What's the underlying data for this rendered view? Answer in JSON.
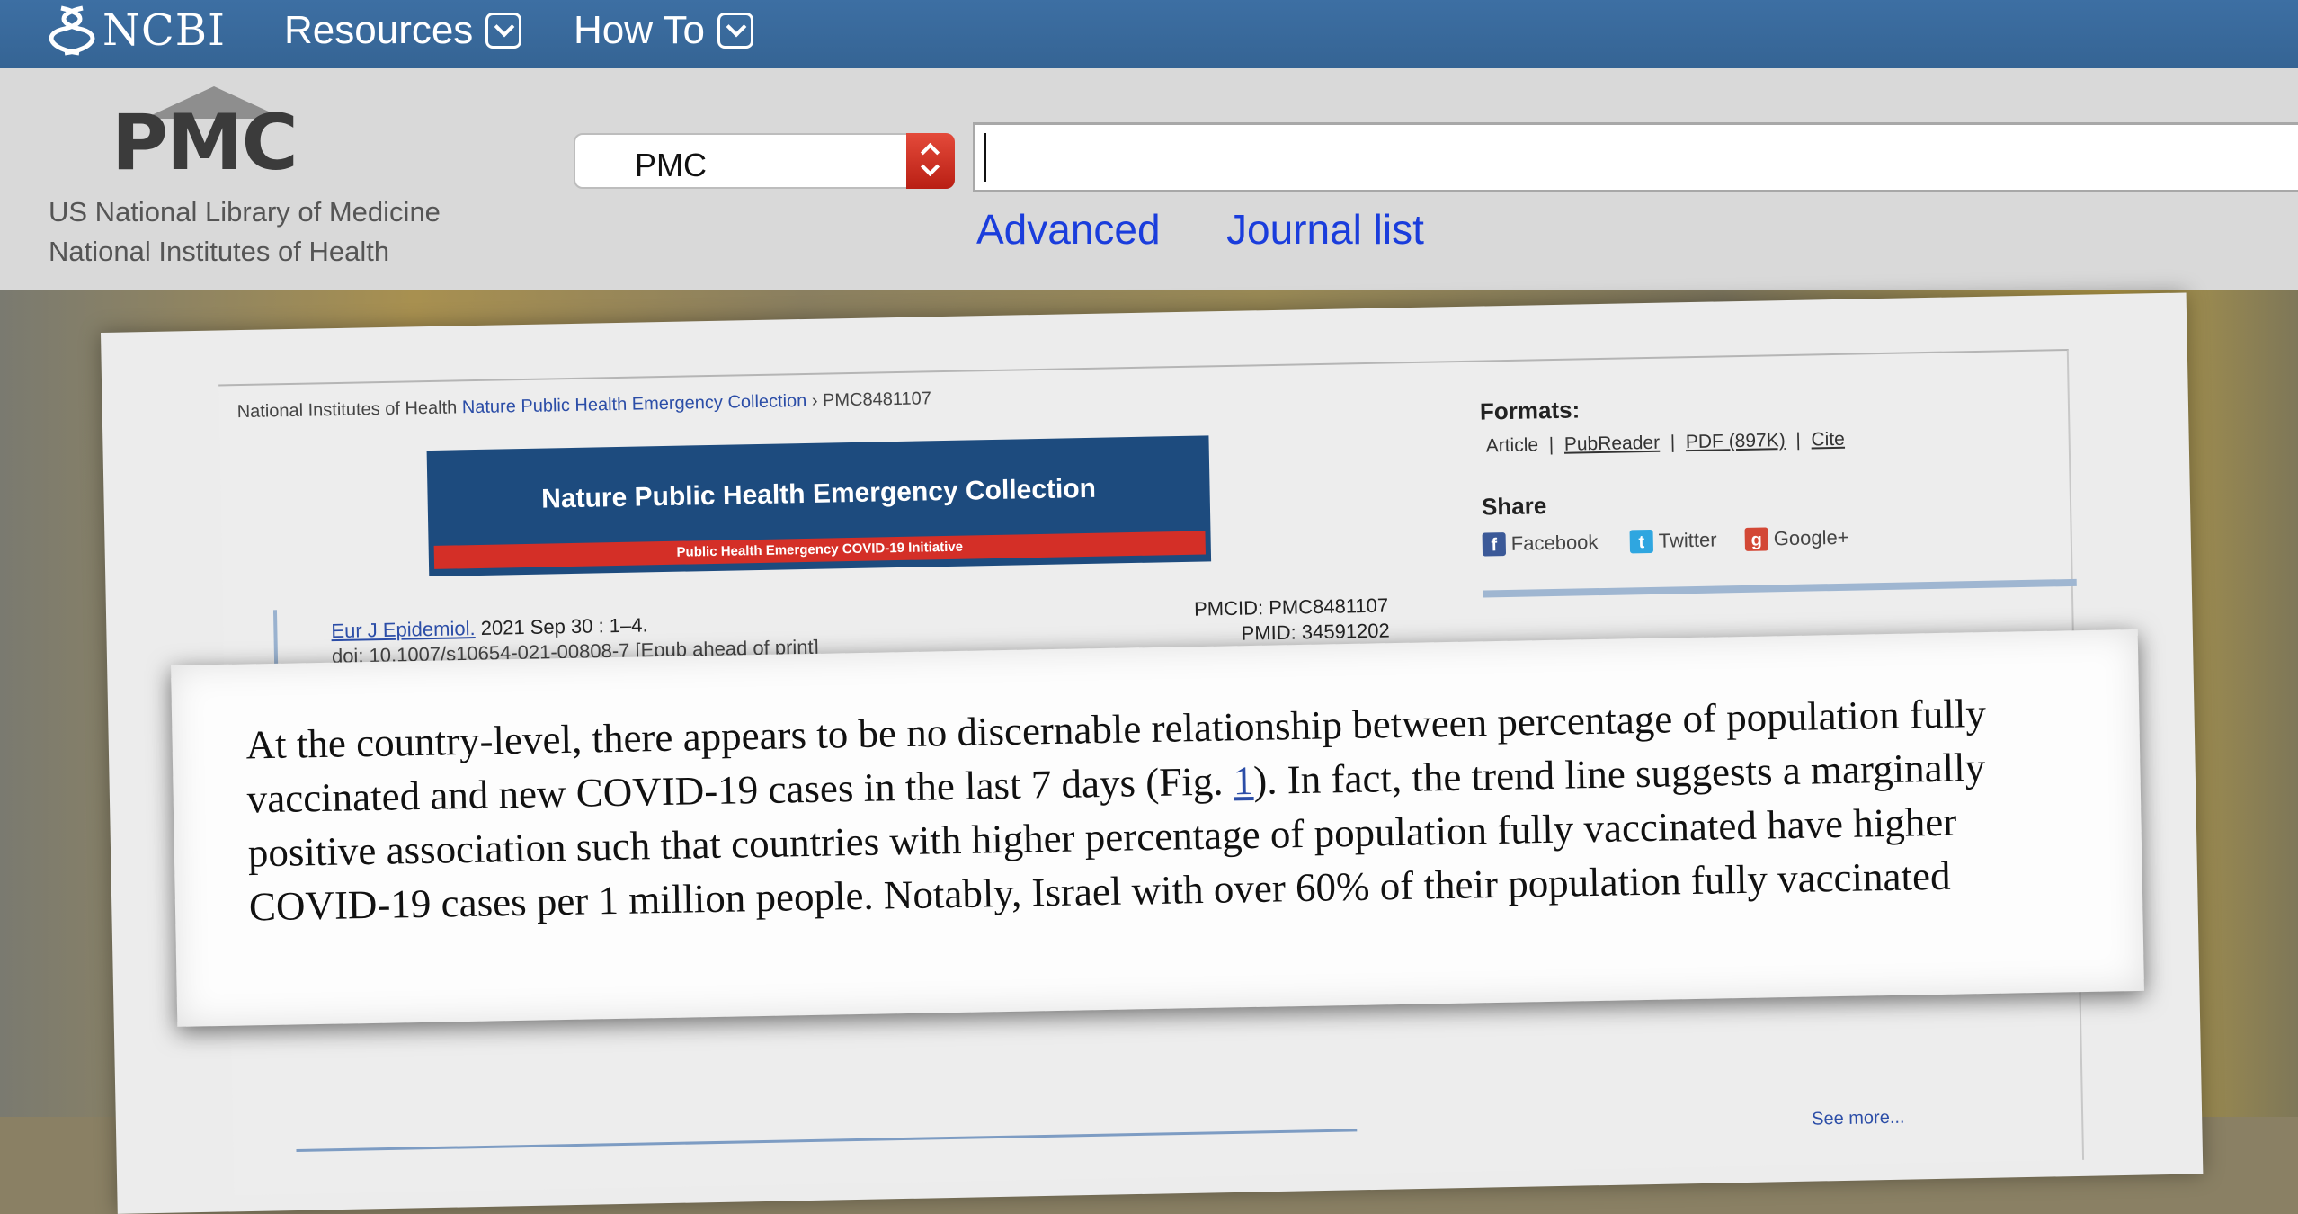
{
  "ncbi_bar": {
    "logo_text": "NCBI",
    "menu": [
      {
        "label": "Resources"
      },
      {
        "label": "How To"
      }
    ]
  },
  "pmc_header": {
    "logo_text": "PMC",
    "org_line1": "US National Library of Medicine",
    "org_line2": "National Institutes of Health",
    "database_select": "PMC",
    "search_value": "",
    "links": {
      "advanced": "Advanced",
      "journal_list": "Journal list"
    }
  },
  "article_page": {
    "breadcrumb_prefix": "National Institutes of Health",
    "breadcrumb_link": "Nature Public Health Emergency Collection",
    "breadcrumb_current": "› PMC8481107",
    "banner_title": "Nature Public Health Emergency Collection",
    "banner_subtitle": "Public Health Emergency COVID-19 Initiative",
    "journal": "Eur J Epidemiol.",
    "journal_date": "2021 Sep 30 : 1–4.",
    "doi": "doi: 10.1007/s10654-021-00808-7 [Epub ahead of print]",
    "pmcid": "PMCID: PMC8481107",
    "pmid": "PMID: 34591202",
    "formats_heading": "Formats:",
    "formats": {
      "article": "Article",
      "pubreader": "PubReader",
      "pdf": "PDF (897K)",
      "cite": "Cite"
    },
    "share_heading": "Share",
    "share": {
      "facebook": "Facebook",
      "twitter": "Twitter",
      "google": "Google+"
    },
    "see_more": "See more..."
  },
  "quote": {
    "text_before": "At the country-level, there appears to be no discernable relationship between percentage of population fully vaccinated and new COVID-19 cases in the last 7 days (Fig. ",
    "fig_ref": "1",
    "text_after": "). In fact, the trend line suggests a marginally positive association such that countries with higher percentage of population fully vaccinated have higher COVID-19 cases per 1 million people. Notably, Israel with over 60% of their population fully vaccinated"
  },
  "colors": {
    "ncbi_bar": "#3d6fa3",
    "header_bg": "#d9d9d9",
    "link_blue": "#1a3ddc",
    "banner_blue": "#1d4b7e",
    "banner_red": "#d42f27",
    "select_arrow_red": "#c62a1d"
  }
}
